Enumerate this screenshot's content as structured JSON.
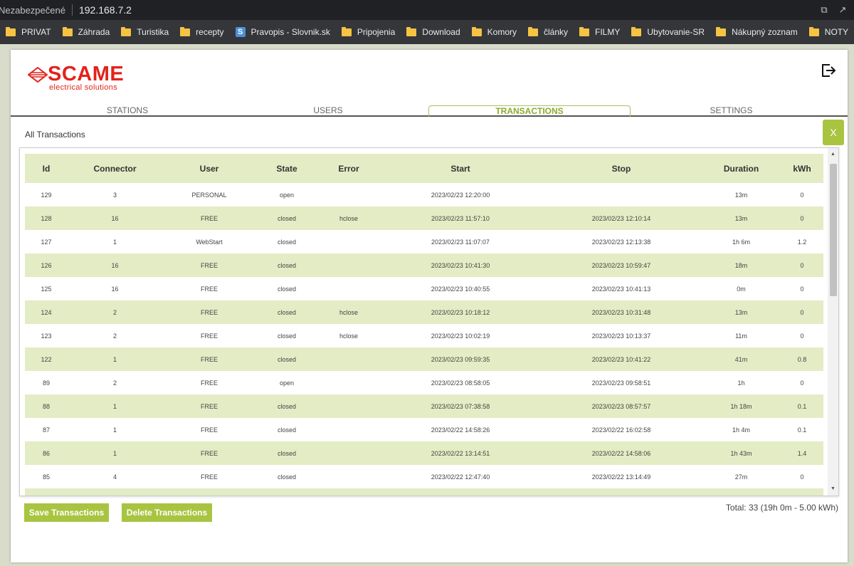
{
  "browser": {
    "insecure_label": "Nezabezpečené",
    "url": "192.168.7.2",
    "bookmarks": [
      {
        "label": "PRIVAT",
        "icon": "folder-icon"
      },
      {
        "label": "Záhrada",
        "icon": "folder-icon"
      },
      {
        "label": "Turistika",
        "icon": "folder-icon"
      },
      {
        "label": "recepty",
        "icon": "folder-icon"
      },
      {
        "label": "Pravopis - Slovnik.sk",
        "icon": "s-icon"
      },
      {
        "label": "Pripojenia",
        "icon": "folder-icon"
      },
      {
        "label": "Download",
        "icon": "folder-icon"
      },
      {
        "label": "Komory",
        "icon": "folder-icon"
      },
      {
        "label": "články",
        "icon": "folder-icon"
      },
      {
        "label": "FILMY",
        "icon": "folder-icon"
      },
      {
        "label": "Ubytovanie-SR",
        "icon": "folder-icon"
      },
      {
        "label": "Nákupný zoznam",
        "icon": "folder-icon"
      },
      {
        "label": "NOTY",
        "icon": "folder-icon"
      }
    ]
  },
  "header": {
    "logo_text": "SCAME",
    "logo_sub": "electrical solutions"
  },
  "tabs": [
    {
      "label": "STATIONS",
      "active": false
    },
    {
      "label": "USERS",
      "active": false
    },
    {
      "label": "TRANSACTIONS",
      "active": true
    },
    {
      "label": "SETTINGS",
      "active": false
    }
  ],
  "section_title": "All Transactions",
  "close_label": "X",
  "table": {
    "columns": [
      "Id",
      "Connector",
      "User",
      "State",
      "Error",
      "Start",
      "Stop",
      "Duration",
      "kWh"
    ],
    "rows": [
      [
        "129",
        "3",
        "PERSONAL",
        "open",
        "",
        "2023/02/23 12:20:00",
        "",
        "13m",
        "0"
      ],
      [
        "128",
        "16",
        "FREE",
        "closed",
        "hclose",
        "2023/02/23 11:57:10",
        "2023/02/23 12:10:14",
        "13m",
        "0"
      ],
      [
        "127",
        "1",
        "WebStart",
        "closed",
        "",
        "2023/02/23 11:07:07",
        "2023/02/23 12:13:38",
        "1h 6m",
        "1.2"
      ],
      [
        "126",
        "16",
        "FREE",
        "closed",
        "",
        "2023/02/23 10:41:30",
        "2023/02/23 10:59:47",
        "18m",
        "0"
      ],
      [
        "125",
        "16",
        "FREE",
        "closed",
        "",
        "2023/02/23 10:40:55",
        "2023/02/23 10:41:13",
        "0m",
        "0"
      ],
      [
        "124",
        "2",
        "FREE",
        "closed",
        "hclose",
        "2023/02/23 10:18:12",
        "2023/02/23 10:31:48",
        "13m",
        "0"
      ],
      [
        "123",
        "2",
        "FREE",
        "closed",
        "hclose",
        "2023/02/23 10:02:19",
        "2023/02/23 10:13:37",
        "11m",
        "0"
      ],
      [
        "122",
        "1",
        "FREE",
        "closed",
        "",
        "2023/02/23 09:59:35",
        "2023/02/23 10:41:22",
        "41m",
        "0.8"
      ],
      [
        "89",
        "2",
        "FREE",
        "open",
        "",
        "2023/02/23 08:58:05",
        "2023/02/23 09:58:51",
        "1h",
        "0"
      ],
      [
        "88",
        "1",
        "FREE",
        "closed",
        "",
        "2023/02/23 07:38:58",
        "2023/02/23 08:57:57",
        "1h 18m",
        "0.1"
      ],
      [
        "87",
        "1",
        "FREE",
        "closed",
        "",
        "2023/02/22 14:58:26",
        "2023/02/22 16:02:58",
        "1h 4m",
        "0.1"
      ],
      [
        "86",
        "1",
        "FREE",
        "closed",
        "",
        "2023/02/22 13:14:51",
        "2023/02/22 14:58:06",
        "1h 43m",
        "1.4"
      ],
      [
        "85",
        "4",
        "FREE",
        "closed",
        "",
        "2023/02/22 12:47:40",
        "2023/02/22 13:14:49",
        "27m",
        "0"
      ]
    ]
  },
  "buttons": {
    "save": "Save Transactions",
    "delete": "Delete Transactions"
  },
  "total": "Total: 33 (19h 0m - 5.00 kWh)",
  "colors": {
    "accent": "#a9c441",
    "row_alt": "#e3ecc4",
    "brand": "#e2231a"
  }
}
